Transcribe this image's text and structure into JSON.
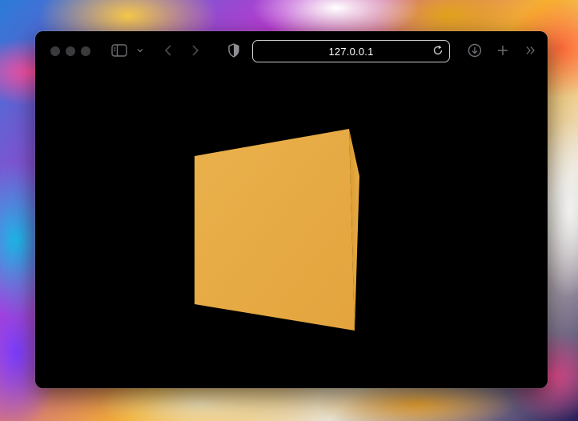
{
  "browser": {
    "url": "127.0.0.1"
  },
  "icons": {
    "sidebar": "sidebar-icon",
    "chevron": "chevron-down-icon",
    "back": "back-arrow-icon",
    "forward": "forward-arrow-icon",
    "shield": "shield-icon",
    "reload": "reload-icon",
    "download": "download-icon",
    "new_tab": "plus-icon",
    "more": "double-chevron-icon"
  },
  "scene": {
    "object": "cube",
    "color": "#e9ae45"
  }
}
